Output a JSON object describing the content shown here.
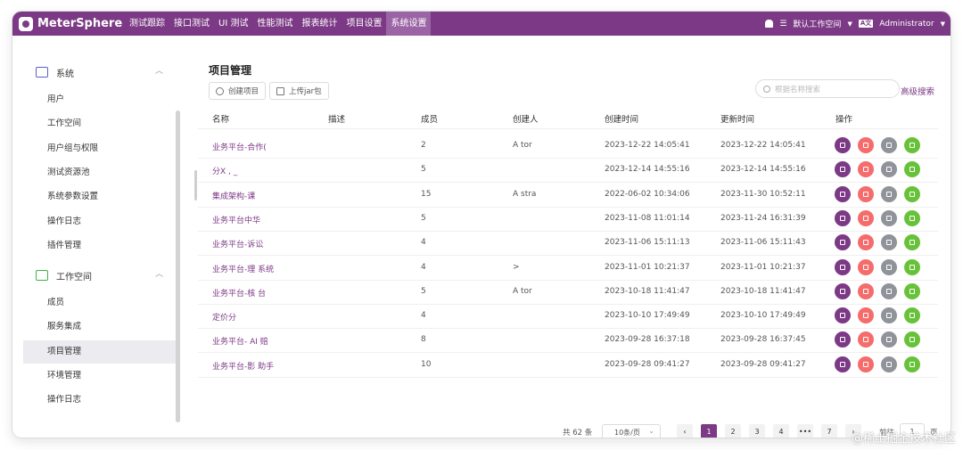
{
  "app": {
    "name": "MeterSphere"
  },
  "nav": {
    "items": [
      "测试跟踪",
      "接口测试",
      "UI 测试",
      "性能测试",
      "报表统计",
      "项目设置",
      "系统设置"
    ],
    "active_index": 6
  },
  "topbar": {
    "workspace": "默认工作空间",
    "lang": "A文",
    "user": "Administrator"
  },
  "sidebar": {
    "system": {
      "label": "系统",
      "items": [
        "用户",
        "工作空间",
        "用户组与权限",
        "测试资源池",
        "系统参数设置",
        "操作日志",
        "插件管理"
      ]
    },
    "workspace": {
      "label": "工作空间",
      "items": [
        "成员",
        "服务集成",
        "项目管理",
        "环境管理",
        "操作日志"
      ]
    },
    "active_item": "项目管理"
  },
  "page": {
    "title": "项目管理"
  },
  "toolbar": {
    "create_label": "创建项目",
    "upload_label": "上传jar包",
    "search_placeholder": "根据名称搜索",
    "advanced_search": "高级搜索"
  },
  "table": {
    "headers": {
      "name": "名称",
      "desc": "描述",
      "members": "成员",
      "creator": "创建人",
      "created": "创建时间",
      "updated": "更新时间",
      "ops": "操作"
    },
    "rows": [
      {
        "name": "业务平台-合作(",
        "members": "2",
        "creator": "A          tor",
        "created": "2023-12-22 14:05:41",
        "updated": "2023-12-22 14:05:41"
      },
      {
        "name": "分X ,  _",
        "members": "5",
        "creator": "",
        "created": "2023-12-14 14:55:16",
        "updated": "2023-12-14 14:55:16"
      },
      {
        "name": "集成架构-课",
        "members": "15",
        "creator": "A        stra",
        "created": "2022-06-02 10:34:06",
        "updated": "2023-11-30 10:52:11"
      },
      {
        "name": "业务平台中华",
        "members": "5",
        "creator": "",
        "created": "2023-11-08 11:01:14",
        "updated": "2023-11-24 16:31:39"
      },
      {
        "name": "业务平台-诉讼",
        "members": "4",
        "creator": "",
        "created": "2023-11-06 15:11:13",
        "updated": "2023-11-06 15:11:43"
      },
      {
        "name": "业务平台-理    系统",
        "members": "4",
        "creator": ">",
        "created": "2023-11-01 10:21:37",
        "updated": "2023-11-01 10:21:37"
      },
      {
        "name": "业务平台-核      台",
        "members": "5",
        "creator": "A           tor",
        "created": "2023-10-18 11:41:47",
        "updated": "2023-10-18 11:41:47"
      },
      {
        "name": "定价分",
        "members": "4",
        "creator": "",
        "created": "2023-10-10 17:49:49",
        "updated": "2023-10-10 17:49:49"
      },
      {
        "name": "业务平台- AI      赔",
        "members": "8",
        "creator": "",
        "created": "2023-09-28 16:37:18",
        "updated": "2023-09-28 16:37:45"
      },
      {
        "name": "业务平台-影    助手",
        "members": "10",
        "creator": "",
        "created": "2023-09-28 09:41:27",
        "updated": "2023-09-28 09:41:27"
      }
    ]
  },
  "pagination": {
    "total": "共 62 条",
    "page_size": "10条/页",
    "pages": [
      "1",
      "2",
      "3",
      "4",
      "•••",
      "7"
    ],
    "current": "1",
    "prev": "‹",
    "next": "›",
    "goto_label": "前往",
    "goto_value": "1",
    "page_unit": "页"
  },
  "watermark": "@稀土掘金技术社区"
}
